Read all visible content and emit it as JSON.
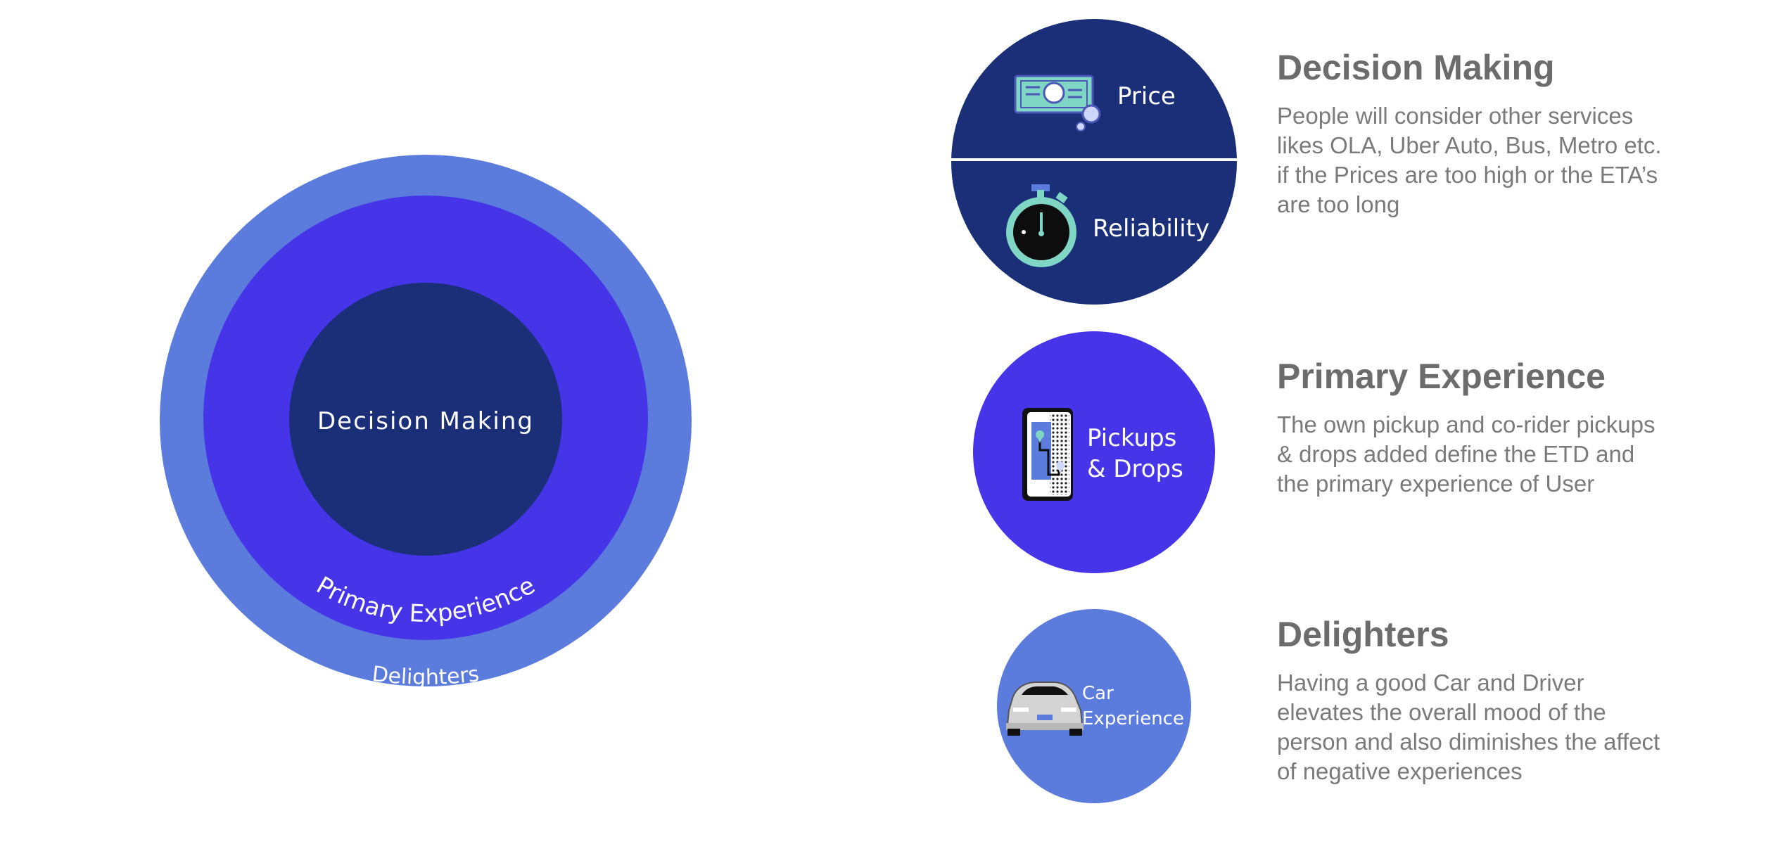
{
  "colors": {
    "delighters": "#5b7bdd",
    "primary_experience": "#4634e8",
    "decision_making": "#1a2f78",
    "heading_text": "#6c6c6c",
    "body_text": "#7a7a7a",
    "icon_accent": "#7fd6c4"
  },
  "onion_diagram": {
    "core_label": "Decision Making",
    "middle_label": "Primary Experience",
    "outer_label": "Delighters"
  },
  "factor_circles": {
    "decision_making": {
      "top_label": "Price",
      "top_icon": "banknote-icon",
      "bottom_label": "Reliability",
      "bottom_icon": "stopwatch-icon"
    },
    "primary_experience": {
      "label_line1": "Pickups",
      "label_line2": "& Drops",
      "icon": "phone-map-icon"
    },
    "delighters": {
      "label_line1": "Car",
      "label_line2": "Experience",
      "icon": "car-icon"
    }
  },
  "sections": [
    {
      "heading": "Decision Making",
      "body": "People will consider other services likes OLA, Uber Auto, Bus, Metro etc. if the Prices are too high or the ETA’s are too long"
    },
    {
      "heading": "Primary Experience",
      "body": "The own pickup and co-rider pickups & drops added define the ETD and the primary experience of User"
    },
    {
      "heading": "Delighters",
      "body": "Having a good Car and Driver elevates the overall mood of the person and also diminishes the affect of negative experiences"
    }
  ]
}
